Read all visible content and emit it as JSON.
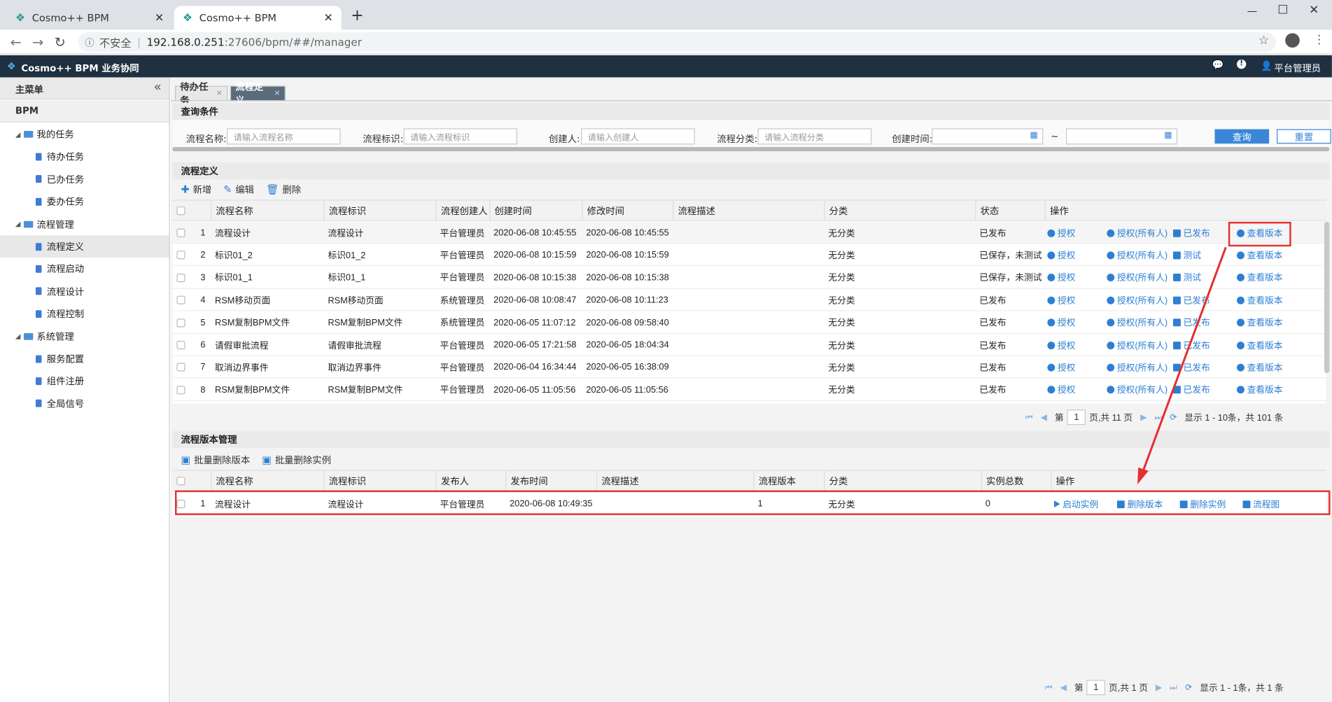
{
  "browser": {
    "tabs": [
      {
        "title": "Cosmo++ BPM",
        "active": false
      },
      {
        "title": "Cosmo++ BPM",
        "active": true
      }
    ],
    "security_label": "不安全",
    "url_host": "192.168.0.251",
    "url_rest": ":27606/bpm/##/manager"
  },
  "app": {
    "title": "Cosmo++ BPM 业务协同",
    "user": "平台管理员"
  },
  "sidebar": {
    "header": "主菜单",
    "section": "BPM",
    "items": [
      {
        "label": "我的任务",
        "level": 1,
        "folder": true
      },
      {
        "label": "待办任务",
        "level": 2
      },
      {
        "label": "已办任务",
        "level": 2
      },
      {
        "label": "委办任务",
        "level": 2
      },
      {
        "label": "流程管理",
        "level": 1,
        "folder": true
      },
      {
        "label": "流程定义",
        "level": 2,
        "active": true
      },
      {
        "label": "流程启动",
        "level": 2
      },
      {
        "label": "流程设计",
        "level": 2
      },
      {
        "label": "流程控制",
        "level": 2
      },
      {
        "label": "系统管理",
        "level": 1,
        "folder": true
      },
      {
        "label": "服务配置",
        "level": 2
      },
      {
        "label": "组件注册",
        "level": 2
      },
      {
        "label": "全局信号",
        "level": 2
      }
    ]
  },
  "page_tabs": [
    {
      "label": "待办任务",
      "active": false
    },
    {
      "label": "流程定义",
      "active": true
    }
  ],
  "query": {
    "title": "查询条件",
    "fields": [
      {
        "label": "流程名称:",
        "placeholder": "请输入流程名称"
      },
      {
        "label": "流程标识:",
        "placeholder": "请输入流程标识"
      },
      {
        "label": "创建人:",
        "placeholder": "请输入创建人"
      },
      {
        "label": "流程分类:",
        "placeholder": "请输入流程分类"
      }
    ],
    "time_label": "创建时间:",
    "range_sep": "~",
    "search_label": "查询",
    "reset_label": "重置"
  },
  "definitions": {
    "title": "流程定义",
    "toolbar": [
      "新增",
      "编辑",
      "删除"
    ],
    "columns": [
      "流程名称",
      "流程标识",
      "流程创建人",
      "创建时间",
      "修改时间",
      "流程描述",
      "分类",
      "状态",
      "操作"
    ],
    "rows": [
      {
        "no": "1",
        "name": "流程设计",
        "key": "流程设计",
        "creator": "平台管理员",
        "created": "2020-06-08 10:45:55",
        "modified": "2020-06-08 10:45:55",
        "desc": "",
        "category": "无分类",
        "status": "已发布",
        "op3": "已发布"
      },
      {
        "no": "2",
        "name": "标识01_2",
        "key": "标识01_2",
        "creator": "平台管理员",
        "created": "2020-06-08 10:15:59",
        "modified": "2020-06-08 10:15:59",
        "desc": "",
        "category": "无分类",
        "status": "已保存，未测试",
        "op3": "测试"
      },
      {
        "no": "3",
        "name": "标识01_1",
        "key": "标识01_1",
        "creator": "平台管理员",
        "created": "2020-06-08 10:15:38",
        "modified": "2020-06-08 10:15:38",
        "desc": "",
        "category": "无分类",
        "status": "已保存，未测试",
        "op3": "测试"
      },
      {
        "no": "4",
        "name": "RSM移动页面",
        "key": "RSM移动页面",
        "creator": "系统管理员",
        "created": "2020-06-08 10:08:47",
        "modified": "2020-06-08 10:11:23",
        "desc": "",
        "category": "无分类",
        "status": "已发布",
        "op3": "已发布"
      },
      {
        "no": "5",
        "name": "RSM复制BPM文件",
        "key": "RSM复制BPM文件",
        "creator": "系统管理员",
        "created": "2020-06-05 11:07:12",
        "modified": "2020-06-08 09:58:40",
        "desc": "",
        "category": "无分类",
        "status": "已发布",
        "op3": "已发布"
      },
      {
        "no": "6",
        "name": "请假审批流程",
        "key": "请假审批流程",
        "creator": "平台管理员",
        "created": "2020-06-05 17:21:58",
        "modified": "2020-06-05 18:04:34",
        "desc": "",
        "category": "无分类",
        "status": "已发布",
        "op3": "已发布"
      },
      {
        "no": "7",
        "name": "取消边界事件",
        "key": "取消边界事件",
        "creator": "平台管理员",
        "created": "2020-06-04 16:34:44",
        "modified": "2020-06-05 16:38:09",
        "desc": "",
        "category": "无分类",
        "status": "已发布",
        "op3": "已发布"
      },
      {
        "no": "8",
        "name": "RSM复制BPM文件",
        "key": "RSM复制BPM文件",
        "creator": "平台管理员",
        "created": "2020-06-05 11:05:56",
        "modified": "2020-06-05 11:05:56",
        "desc": "",
        "category": "无分类",
        "status": "已发布",
        "op3": "已发布"
      }
    ],
    "op_authorize": "授权",
    "op_authorize_all": "授权(所有人)",
    "op_versions": "查看版本",
    "pager": {
      "prefix": "第",
      "page": "1",
      "suffix": "页,共 11 页",
      "summary": "显示 1 - 10条，共 101 条"
    }
  },
  "versions": {
    "title": "流程版本管理",
    "toolbar": [
      "批量删除版本",
      "批量删除实例"
    ],
    "columns": [
      "流程名称",
      "流程标识",
      "发布人",
      "发布时间",
      "流程描述",
      "流程版本",
      "分类",
      "实例总数",
      "操作"
    ],
    "rows": [
      {
        "no": "1",
        "name": "流程设计",
        "key": "流程设计",
        "publisher": "平台管理员",
        "published": "2020-06-08 10:49:35",
        "desc": "",
        "version": "1",
        "category": "无分类",
        "instances": "0"
      }
    ],
    "ops": [
      "启动实例",
      "删除版本",
      "删除实例",
      "流程图"
    ],
    "pager": {
      "prefix": "第",
      "page": "1",
      "suffix": "页,共 1 页",
      "summary": "显示 1 - 1条，共 1 条"
    }
  }
}
